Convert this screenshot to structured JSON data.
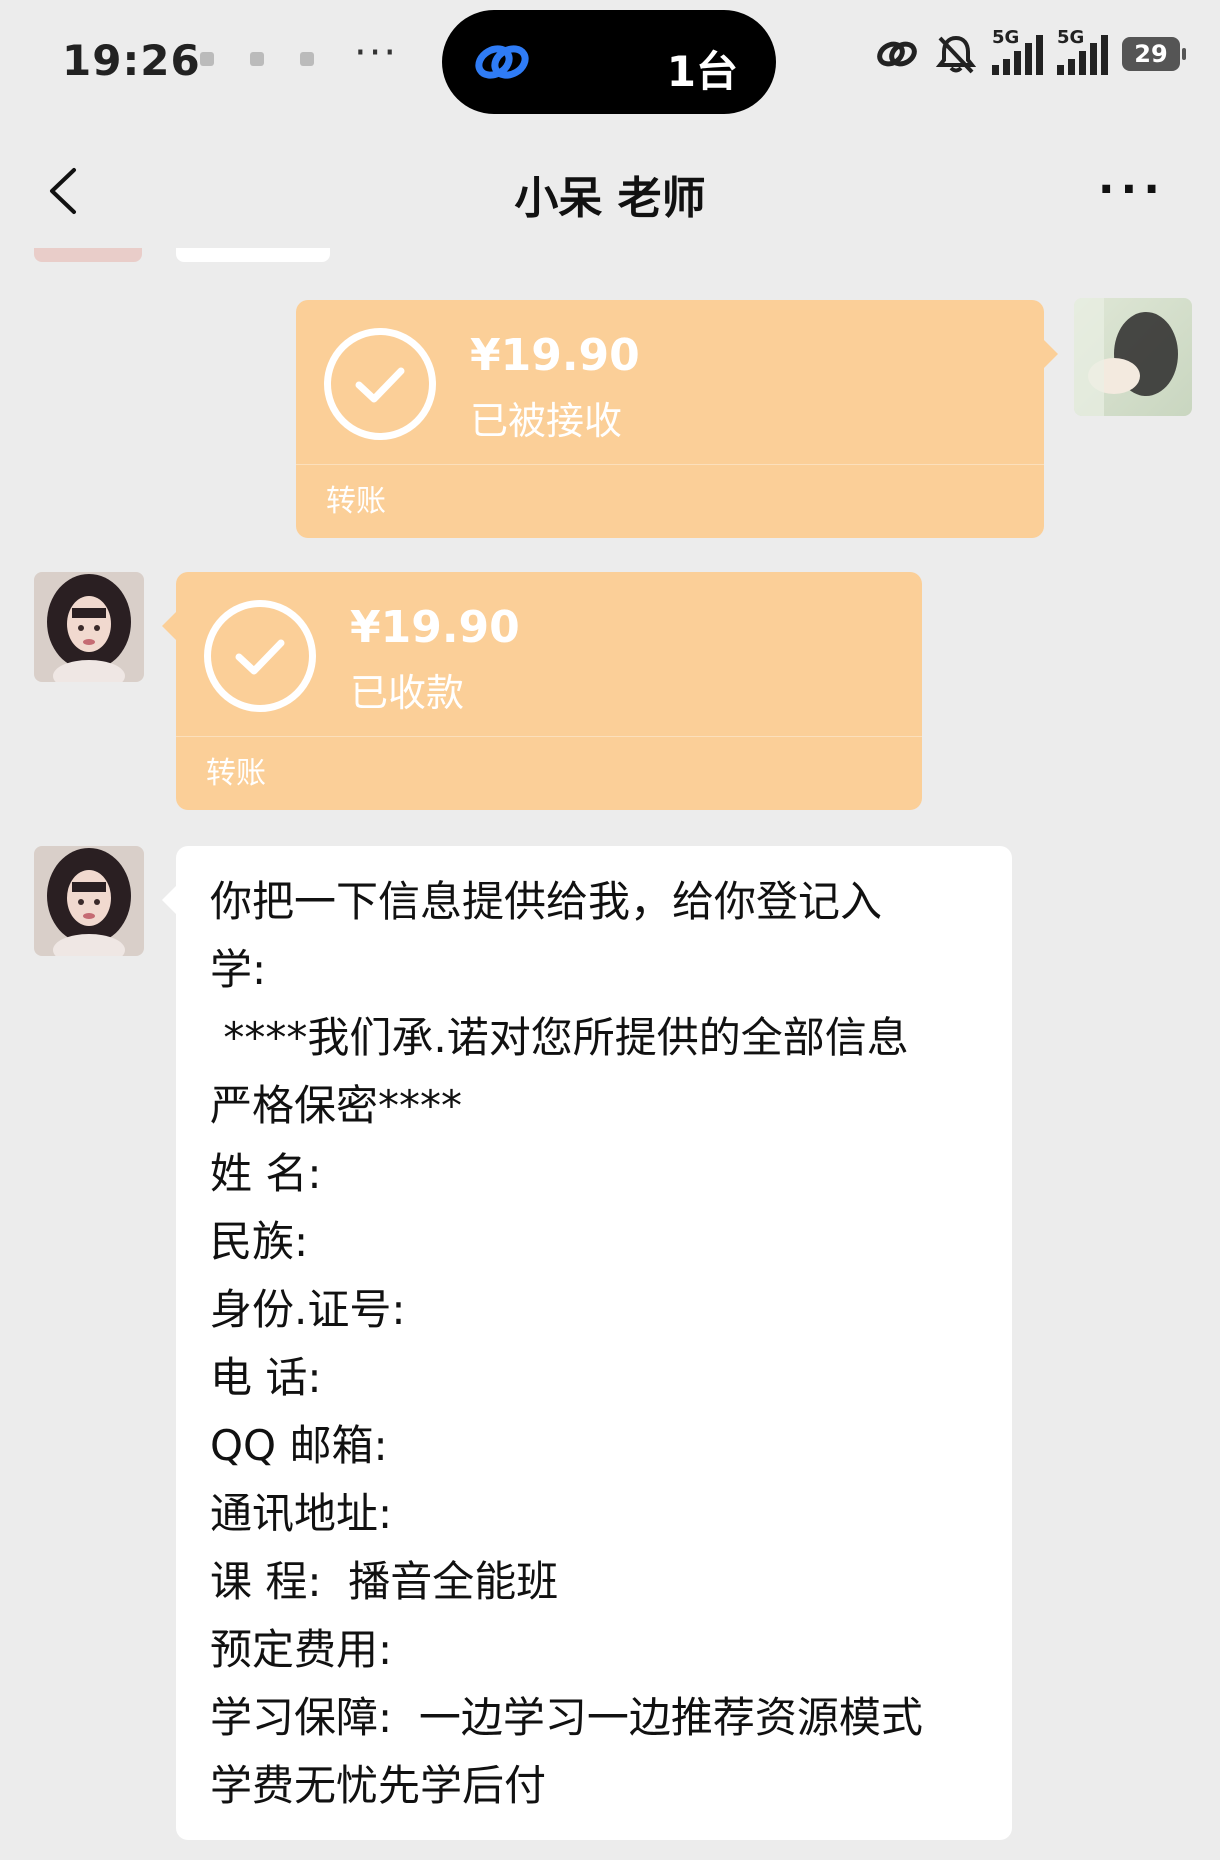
{
  "status_bar": {
    "time": "19:26",
    "island_text": "1台",
    "signal_label_1": "5G",
    "signal_label_2": "5G",
    "battery": "29"
  },
  "header": {
    "title": "小呆 老师"
  },
  "messages": {
    "sent_transfer": {
      "amount": "¥19.90",
      "status": "已被接收",
      "label": "转账"
    },
    "received_transfer": {
      "amount": "¥19.90",
      "status": "已收款",
      "label": "转账"
    },
    "text_message": {
      "lines": [
        "你把一下信息提供给我，给你登记入",
        "学:",
        " ****我们承.诺对您所提供的全部信息",
        "严格保密****",
        "姓 名:",
        "民族:",
        "身份.证号:",
        "电 话:",
        "QQ 邮箱:",
        "通讯地址:",
        "课 程:  播音全能班",
        "预定费用:",
        "学习保障:  一边学习一边推荐资源模式",
        "学费无忧先学后付"
      ]
    }
  },
  "colors": {
    "background": "#ececec",
    "transfer_bubble": "#fbcf98",
    "text_bubble": "#ffffff"
  }
}
